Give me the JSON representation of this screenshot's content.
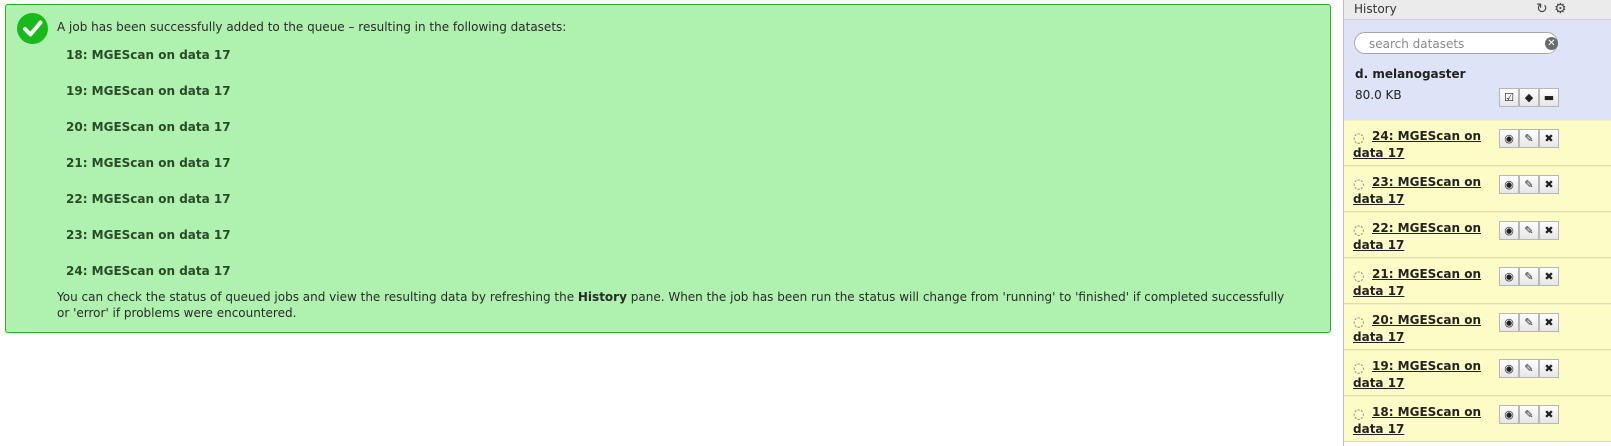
{
  "message": {
    "headline": "A job has been successfully added to the queue – resulting in the following datasets:",
    "datasets": [
      "18: MGEScan on data 17",
      "19: MGEScan on data 17",
      "20: MGEScan on data 17",
      "21: MGEScan on data 17",
      "22: MGEScan on data 17",
      "23: MGEScan on data 17",
      "24: MGEScan on data 17"
    ],
    "footer_before": "You can check the status of queued jobs and view the resulting data by refreshing the ",
    "footer_bold": "History",
    "footer_after": " pane. When the job has been run the status will change from 'running' to 'finished' if completed successfully or 'error' if problems were encountered."
  },
  "history": {
    "title": "History",
    "search_placeholder": "search datasets",
    "name": "d. melanogaster",
    "size": "80.0 KB",
    "items": [
      {
        "label": "24: MGEScan on data 17"
      },
      {
        "label": "23: MGEScan on data 17"
      },
      {
        "label": "22: MGEScan on data 17"
      },
      {
        "label": "21: MGEScan on data 17"
      },
      {
        "label": "20: MGEScan on data 17"
      },
      {
        "label": "19: MGEScan on data 17"
      },
      {
        "label": "18: MGEScan on data 17"
      }
    ]
  },
  "icons": {
    "success": "check-circle-icon",
    "refresh": "refresh-icon",
    "options": "gear-icon",
    "clear": "clear-search-icon",
    "select": "checkbox-icon",
    "tags": "tags-icon",
    "annotate": "comment-icon",
    "view": "eye-icon",
    "edit": "pencil-icon",
    "delete": "close-icon",
    "running": "spinner-icon"
  },
  "colors": {
    "message_bg": "#aff1af",
    "message_border": "#20b420",
    "queued_bg": "#fefcc6",
    "history_header_bg": "#dfe3f7"
  }
}
